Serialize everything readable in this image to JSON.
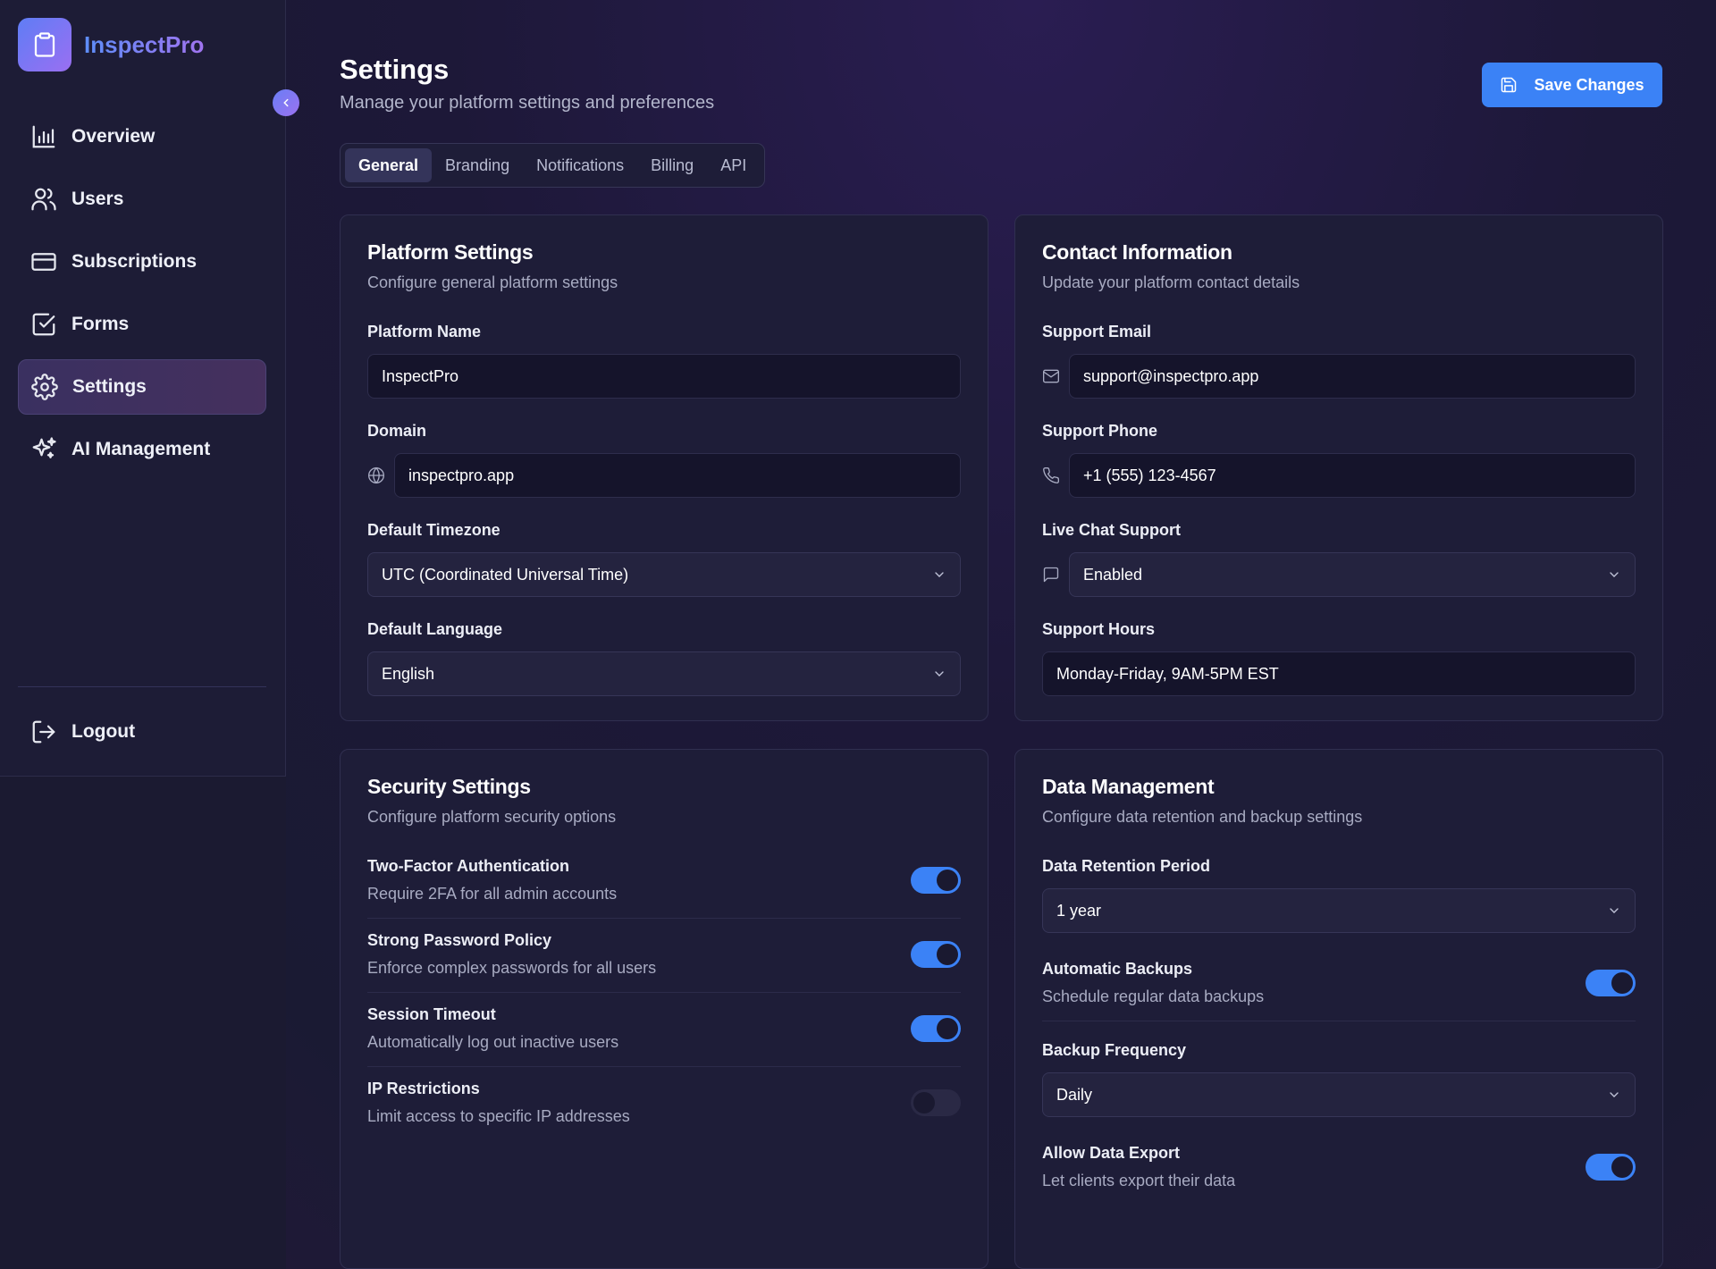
{
  "app": {
    "name": "InspectPro"
  },
  "sidebar": {
    "items": [
      {
        "label": "Overview"
      },
      {
        "label": "Users"
      },
      {
        "label": "Subscriptions"
      },
      {
        "label": "Forms"
      },
      {
        "label": "Settings"
      },
      {
        "label": "AI Management"
      }
    ],
    "logout": "Logout"
  },
  "header": {
    "title": "Settings",
    "subtitle": "Manage your platform settings and preferences",
    "save_label": "Save Changes"
  },
  "tabs": [
    {
      "label": "General",
      "active": true
    },
    {
      "label": "Branding"
    },
    {
      "label": "Notifications"
    },
    {
      "label": "Billing"
    },
    {
      "label": "API"
    }
  ],
  "platform": {
    "title": "Platform Settings",
    "subtitle": "Configure general platform settings",
    "name_label": "Platform Name",
    "name_value": "InspectPro",
    "domain_label": "Domain",
    "domain_value": "inspectpro.app",
    "timezone_label": "Default Timezone",
    "timezone_value": "UTC (Coordinated Universal Time)",
    "language_label": "Default Language",
    "language_value": "English"
  },
  "contact": {
    "title": "Contact Information",
    "subtitle": "Update your platform contact details",
    "email_label": "Support Email",
    "email_value": "support@inspectpro.app",
    "phone_label": "Support Phone",
    "phone_value": "+1 (555) 123-4567",
    "chat_label": "Live Chat Support",
    "chat_value": "Enabled",
    "hours_label": "Support Hours",
    "hours_value": "Monday-Friday, 9AM-5PM EST"
  },
  "security": {
    "title": "Security Settings",
    "subtitle": "Configure platform security options",
    "items": [
      {
        "title": "Two-Factor Authentication",
        "desc": "Require 2FA for all admin accounts",
        "on": true
      },
      {
        "title": "Strong Password Policy",
        "desc": "Enforce complex passwords for all users",
        "on": true
      },
      {
        "title": "Session Timeout",
        "desc": "Automatically log out inactive users",
        "on": true
      },
      {
        "title": "IP Restrictions",
        "desc": "Limit access to specific IP addresses",
        "on": false
      }
    ]
  },
  "data_mgmt": {
    "title": "Data Management",
    "subtitle": "Configure data retention and backup settings",
    "retention_label": "Data Retention Period",
    "retention_value": "1 year",
    "backups_title": "Automatic Backups",
    "backups_desc": "Schedule regular data backups",
    "backups_on": true,
    "frequency_label": "Backup Frequency",
    "frequency_value": "Daily",
    "export_title": "Allow Data Export",
    "export_desc": "Let clients export their data",
    "export_on": true
  },
  "colors": {
    "accent": "#3b82f6",
    "brand_start": "#5d8df8",
    "brand_end": "#a074f0"
  }
}
